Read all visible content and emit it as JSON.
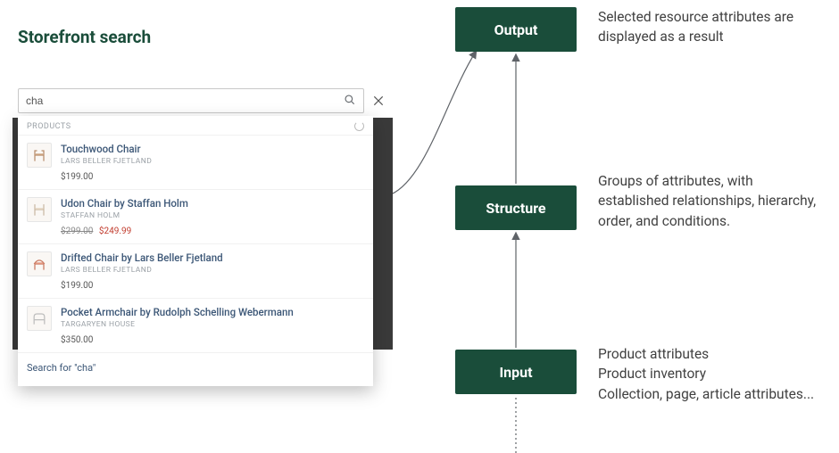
{
  "title": "Storefront search",
  "search": {
    "query": "cha",
    "section_label": "PRODUCTS",
    "search_for_prefix": "Search for",
    "results": [
      {
        "title": "Touchwood Chair",
        "vendor": "LARS BELLER FJETLAND",
        "price": "$199.00"
      },
      {
        "title": "Udon Chair by Staffan Holm",
        "vendor": "STAFFAN HOLM",
        "price_old": "$299.00",
        "price_sale": "$249.99"
      },
      {
        "title": "Drifted Chair by Lars Beller Fjetland",
        "vendor": "LARS BELLER FJETLAND",
        "price": "$199.00"
      },
      {
        "title": "Pocket Armchair by Rudolph Schelling Webermann",
        "vendor": "TARGARYEN HOUSE",
        "price": "$350.00"
      }
    ]
  },
  "diagram": {
    "nodes": {
      "output": {
        "label": "Output",
        "desc": "Selected resource attributes are displayed as a result"
      },
      "structure": {
        "label": "Structure",
        "desc": "Groups of attributes, with established relationships, hierarchy, order, and conditions."
      },
      "input": {
        "label": "Input",
        "desc": "Product attributes\nProduct inventory\nCollection, page, article attributes..."
      }
    }
  }
}
